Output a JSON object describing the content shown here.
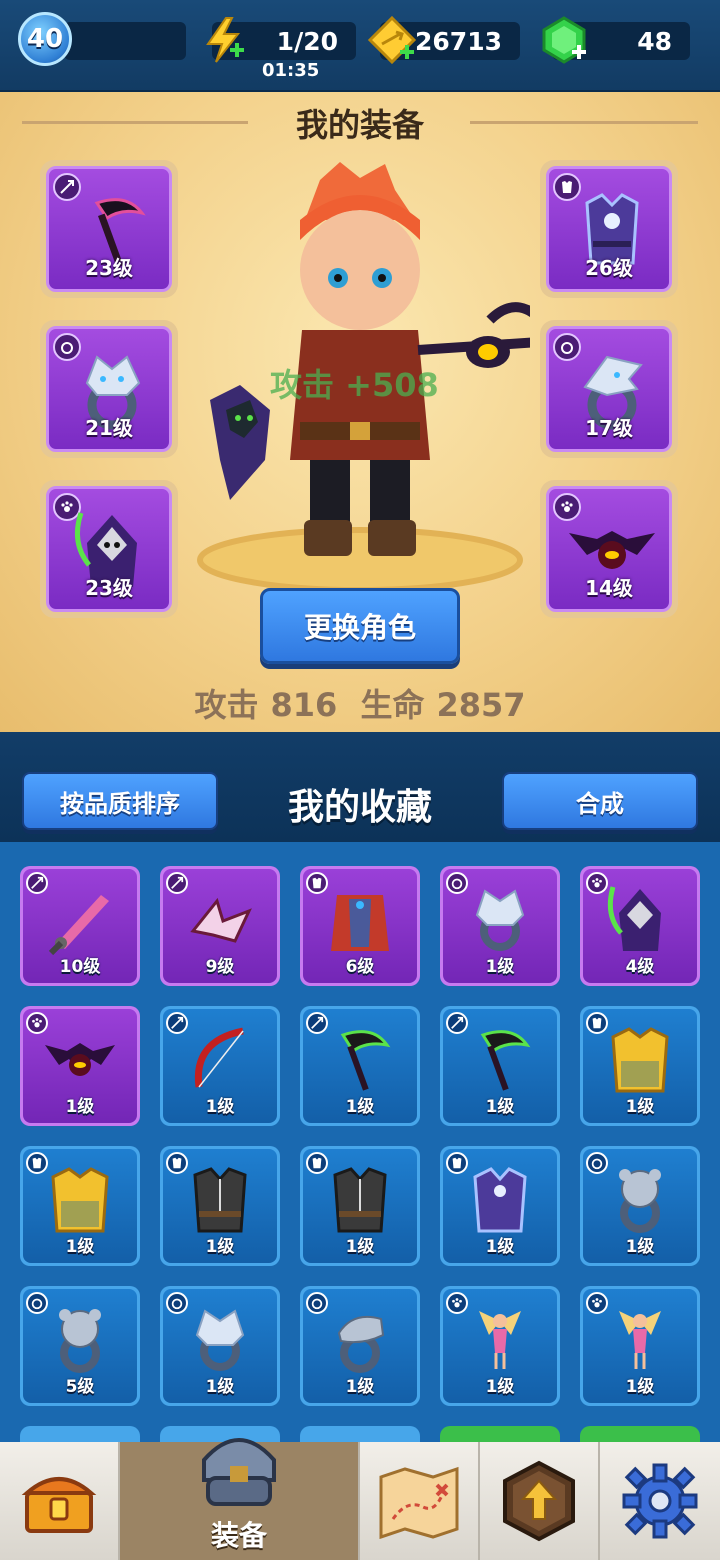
{
  "topbar": {
    "player_level": "40",
    "energy": "1/20",
    "energy_timer": "01:35",
    "coins": "26713",
    "gems": "48"
  },
  "equipment": {
    "title": "我的装备",
    "bonus_text": "攻击 +508",
    "slots": [
      {
        "type": "weapon",
        "level": "23级",
        "icon": "scythe-icon"
      },
      {
        "type": "armor",
        "level": "26级",
        "icon": "armor-icon"
      },
      {
        "type": "ring",
        "level": "21级",
        "icon": "wolf-ring-icon"
      },
      {
        "type": "ring",
        "level": "17级",
        "icon": "dragon-ring-icon"
      },
      {
        "type": "pet",
        "level": "23级",
        "icon": "reaper-pet-icon"
      },
      {
        "type": "pet",
        "level": "14级",
        "icon": "bat-pet-icon"
      }
    ],
    "change_button": "更换角色",
    "attack_label": "攻击",
    "attack_value": "816",
    "hp_label": "生命",
    "hp_value": "2857"
  },
  "collection": {
    "sort_button": "按品质排序",
    "title": "我的收藏",
    "merge_button": "合成",
    "items": [
      {
        "level": "10级",
        "rarity": "purple",
        "type": "weapon",
        "icon": "sword-icon"
      },
      {
        "level": "9级",
        "rarity": "purple",
        "type": "weapon",
        "icon": "shuriken-icon"
      },
      {
        "level": "6级",
        "rarity": "purple",
        "type": "armor",
        "icon": "robe-icon"
      },
      {
        "level": "1级",
        "rarity": "purple",
        "type": "ring",
        "icon": "wolf-ring-icon"
      },
      {
        "level": "4级",
        "rarity": "purple",
        "type": "pet",
        "icon": "reaper-pet-icon"
      },
      {
        "level": "1级",
        "rarity": "purple",
        "type": "pet",
        "icon": "bat-pet-icon"
      },
      {
        "level": "1级",
        "rarity": "blue",
        "type": "weapon",
        "icon": "bow-icon"
      },
      {
        "level": "1级",
        "rarity": "blue",
        "type": "weapon",
        "icon": "scythe-icon"
      },
      {
        "level": "1级",
        "rarity": "blue",
        "type": "weapon",
        "icon": "scythe-icon"
      },
      {
        "level": "1级",
        "rarity": "blue",
        "type": "armor",
        "icon": "gold-armor-icon"
      },
      {
        "level": "1级",
        "rarity": "blue",
        "type": "armor",
        "icon": "gold-armor-icon"
      },
      {
        "level": "1级",
        "rarity": "blue",
        "type": "armor",
        "icon": "vest-icon"
      },
      {
        "level": "1级",
        "rarity": "blue",
        "type": "armor",
        "icon": "vest-icon"
      },
      {
        "level": "1级",
        "rarity": "blue",
        "type": "armor",
        "icon": "armor-icon"
      },
      {
        "level": "1级",
        "rarity": "blue",
        "type": "ring",
        "icon": "bear-ring-icon"
      },
      {
        "level": "5级",
        "rarity": "blue",
        "type": "ring",
        "icon": "bear-ring-icon"
      },
      {
        "level": "1级",
        "rarity": "blue",
        "type": "ring",
        "icon": "wolf-ring-icon"
      },
      {
        "level": "1级",
        "rarity": "blue",
        "type": "ring",
        "icon": "snake-ring-icon"
      },
      {
        "level": "1级",
        "rarity": "blue",
        "type": "pet",
        "icon": "fairy-pet-icon"
      },
      {
        "level": "1级",
        "rarity": "blue",
        "type": "pet",
        "icon": "fairy-pet-icon"
      }
    ]
  },
  "nav": {
    "items": [
      {
        "name": "chest",
        "icon": "chest-icon"
      },
      {
        "name": "equipment",
        "label": "装备",
        "icon": "helmet-icon"
      },
      {
        "name": "map",
        "icon": "map-icon"
      },
      {
        "name": "upgrade",
        "icon": "upgrade-arrow-icon"
      },
      {
        "name": "settings",
        "icon": "gear-icon"
      }
    ]
  },
  "colors": {
    "purple_rarity": "#7a2bc3",
    "blue_rarity": "#135fa8",
    "button_blue": "#2f78e0",
    "panel_gold": "#f3d18b"
  }
}
